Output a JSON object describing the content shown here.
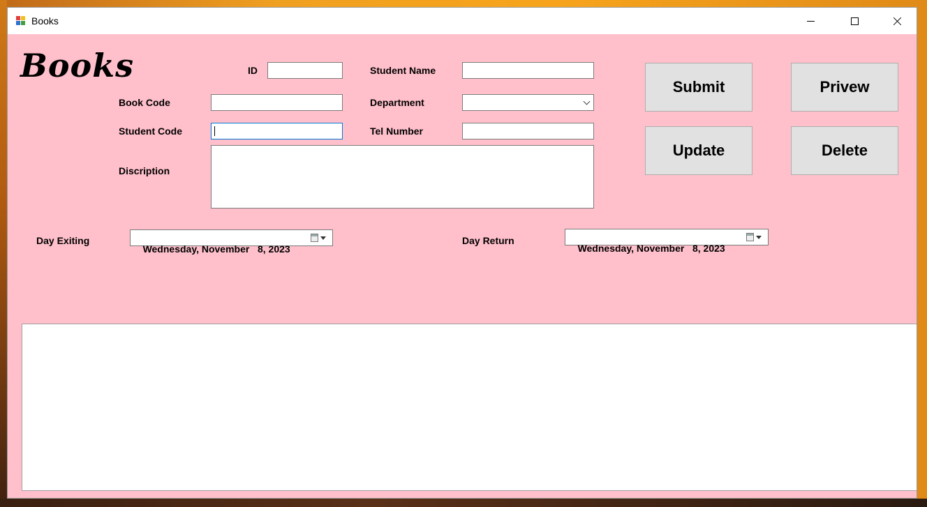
{
  "window": {
    "title": "Books",
    "icon": "winforms-app-icon"
  },
  "titlebar_buttons": {
    "minimize": "minimize-icon",
    "maximize": "maximize-icon",
    "close": "close-icon"
  },
  "form": {
    "heading": "Books",
    "labels": {
      "id": "ID",
      "student_name": "Student Name",
      "book_code": "Book Code",
      "department": "Department",
      "student_code": "Student Code",
      "tel_number": "Tel Number",
      "description": "Discription",
      "day_exiting": "Day Exiting",
      "day_return": "Day Return"
    },
    "values": {
      "id": "",
      "student_name": "",
      "book_code": "",
      "department": "",
      "student_code": "",
      "tel_number": "",
      "description": ""
    },
    "dates": {
      "day_exiting": "Wednesday, November   8, 2023",
      "day_return": "Wednesday, November   8, 2023"
    }
  },
  "buttons": {
    "submit": "Submit",
    "preview": "Privew",
    "update": "Update",
    "delete": "Delete"
  },
  "colors": {
    "form_background": "#ffc0cb",
    "button_face": "#e1e1e1",
    "focus_border": "#0078d7"
  }
}
